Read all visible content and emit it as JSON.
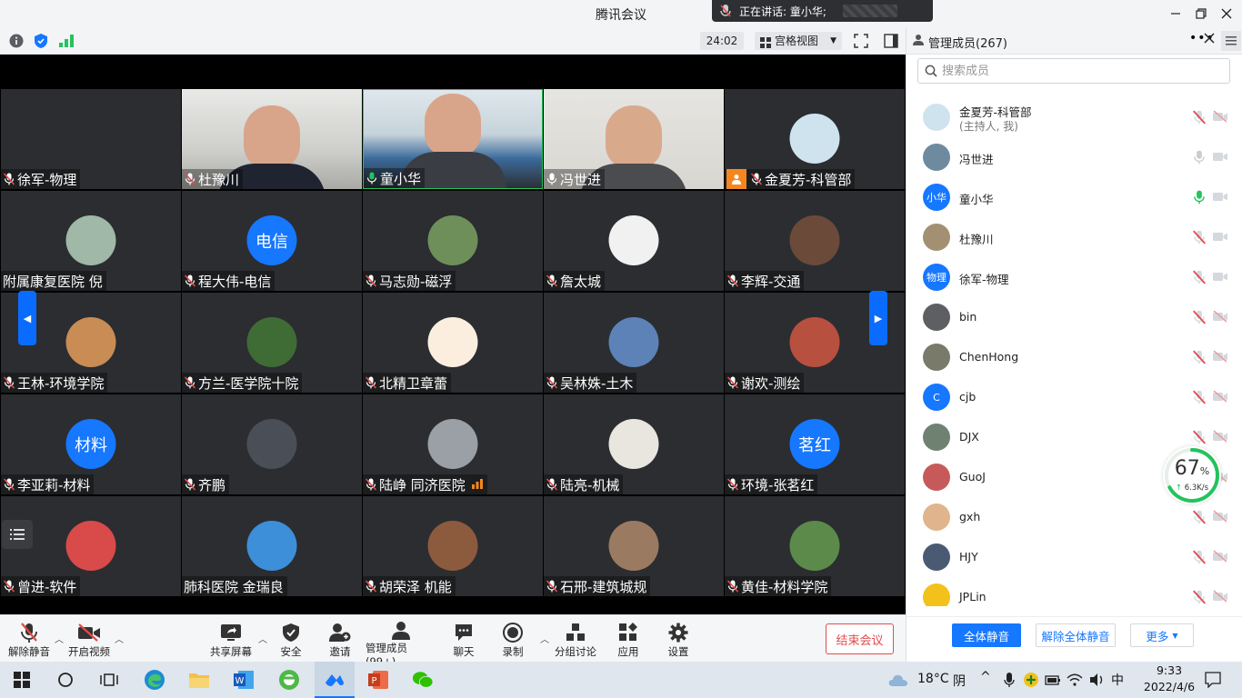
{
  "window": {
    "title": "腾讯会议",
    "speaking_label": "正在讲话: 童小华;"
  },
  "meeting_bar": {
    "timer": "24:02",
    "view_label": "宫格视图"
  },
  "tiles": [
    {
      "name": "徐军-物理",
      "kind": "blank",
      "mic": "muted"
    },
    {
      "name": "杜豫川",
      "kind": "cam1",
      "mic": "muted"
    },
    {
      "name": "童小华",
      "kind": "cam2",
      "mic": "speaking"
    },
    {
      "name": "冯世进",
      "kind": "cam3",
      "mic": "on"
    },
    {
      "name": "金夏芳-科管部",
      "kind": "avatar",
      "avatar_color": "#cfe3ef",
      "avatar_text": "",
      "mic": "muted",
      "host": true
    },
    {
      "name": "附属康复医院 倪",
      "kind": "avatar",
      "avatar_color": "#9fb8a8",
      "avatar_text": "",
      "mic": "none"
    },
    {
      "name": "程大伟-电信",
      "kind": "avatar",
      "avatar_color": "#1677ff",
      "avatar_text": "电信",
      "mic": "muted"
    },
    {
      "name": "马志勋-磁浮",
      "kind": "avatar",
      "avatar_color": "#6f8f5a",
      "avatar_text": "",
      "mic": "muted"
    },
    {
      "name": "詹太城",
      "kind": "avatar",
      "avatar_color": "#f1f1f1",
      "avatar_text": "",
      "mic": "muted"
    },
    {
      "name": "李辉-交通",
      "kind": "avatar",
      "avatar_color": "#6b4a3a",
      "avatar_text": "",
      "mic": "muted"
    },
    {
      "name": "王林-环境学院",
      "kind": "avatar",
      "avatar_color": "#c98c55",
      "avatar_text": "",
      "mic": "muted"
    },
    {
      "name": "方兰-医学院十院",
      "kind": "avatar",
      "avatar_color": "#3f6b34",
      "avatar_text": "",
      "mic": "muted"
    },
    {
      "name": "北精卫章蕾",
      "kind": "avatar",
      "avatar_color": "#fbeede",
      "avatar_text": "",
      "mic": "muted"
    },
    {
      "name": "吴林姝-土木",
      "kind": "avatar",
      "avatar_color": "#5c82b8",
      "avatar_text": "",
      "mic": "muted"
    },
    {
      "name": "谢欢-测绘",
      "kind": "avatar",
      "avatar_color": "#b8503f",
      "avatar_text": "",
      "mic": "muted"
    },
    {
      "name": "李亚莉-材料",
      "kind": "avatar",
      "avatar_color": "#1677ff",
      "avatar_text": "材料",
      "mic": "muted"
    },
    {
      "name": "齐鹏",
      "kind": "avatar",
      "avatar_color": "#4a4e57",
      "avatar_text": "",
      "mic": "muted"
    },
    {
      "name": "陆峥 同济医院",
      "kind": "avatar",
      "avatar_color": "#9aa0a5",
      "avatar_text": "",
      "mic": "muted",
      "signal": true
    },
    {
      "name": "陆亮-机械",
      "kind": "avatar",
      "avatar_color": "#e9e5df",
      "avatar_text": "",
      "mic": "muted"
    },
    {
      "name": "环境-张茗红",
      "kind": "avatar",
      "avatar_color": "#1677ff",
      "avatar_text": "茗红",
      "mic": "muted"
    },
    {
      "name": "曾进-软件",
      "kind": "avatar",
      "avatar_color": "#d94a4a",
      "avatar_text": "",
      "mic": "muted"
    },
    {
      "name": "肺科医院 金瑞良",
      "kind": "avatar",
      "avatar_color": "#3c8fd8",
      "avatar_text": "",
      "mic": "none"
    },
    {
      "name": "胡荣泽 机能",
      "kind": "avatar",
      "avatar_color": "#8c5a3c",
      "avatar_text": "",
      "mic": "muted"
    },
    {
      "name": "石邢-建筑城规",
      "kind": "avatar",
      "avatar_color": "#9b7a62",
      "avatar_text": "",
      "mic": "muted"
    },
    {
      "name": "黄佳-材料学院",
      "kind": "avatar",
      "avatar_color": "#5c8a4a",
      "avatar_text": "",
      "mic": "muted"
    }
  ],
  "toolbar": {
    "unmute": "解除静音",
    "start_video": "开启视频",
    "share_screen": "共享屏幕",
    "security": "安全",
    "invite": "邀请",
    "manage_members": "管理成员(99+)",
    "chat": "聊天",
    "record": "录制",
    "breakout": "分组讨论",
    "apps": "应用",
    "settings": "设置",
    "end_meeting": "结束会议"
  },
  "panel": {
    "title": "管理成员(267)",
    "search_placeholder": "搜索成员",
    "members": [
      {
        "name": "金夏芳-科管部",
        "sub": "(主持人, 我)",
        "avatar_color": "#cfe3ef",
        "avatar_text": "",
        "mic": "muted",
        "cam": "off"
      },
      {
        "name": "冯世进",
        "sub": "",
        "avatar_color": "#6e8a9e",
        "avatar_text": "",
        "mic": "idle",
        "cam": "on"
      },
      {
        "name": "童小华",
        "sub": "",
        "avatar_color": "#1677ff",
        "avatar_text": "小华",
        "mic": "speaking",
        "cam": "on"
      },
      {
        "name": "杜豫川",
        "sub": "",
        "avatar_color": "#a39072",
        "avatar_text": "",
        "mic": "muted",
        "cam": "on"
      },
      {
        "name": "徐军-物理",
        "sub": "",
        "avatar_color": "#1677ff",
        "avatar_text": "物理",
        "mic": "muted",
        "cam": "on"
      },
      {
        "name": "bin",
        "sub": "",
        "avatar_color": "#5d5f63",
        "avatar_text": "",
        "mic": "muted",
        "cam": "off"
      },
      {
        "name": "ChenHong",
        "sub": "",
        "avatar_color": "#7a7a6a",
        "avatar_text": "",
        "mic": "muted",
        "cam": "off"
      },
      {
        "name": "cjb",
        "sub": "",
        "avatar_color": "#1677ff",
        "avatar_text": "C",
        "mic": "muted",
        "cam": "off"
      },
      {
        "name": "DJX",
        "sub": "",
        "avatar_color": "#6f8272",
        "avatar_text": "",
        "mic": "muted",
        "cam": "off"
      },
      {
        "name": "GuoJ",
        "sub": "",
        "avatar_color": "#c65a5a",
        "avatar_text": "",
        "mic": "muted",
        "cam": "off"
      },
      {
        "name": "gxh",
        "sub": "",
        "avatar_color": "#e0b48c",
        "avatar_text": "",
        "mic": "muted",
        "cam": "off"
      },
      {
        "name": "HJY",
        "sub": "",
        "avatar_color": "#4a5a72",
        "avatar_text": "",
        "mic": "muted",
        "cam": "off"
      },
      {
        "name": "JPLin",
        "sub": "",
        "avatar_color": "#f2c21b",
        "avatar_text": "",
        "mic": "muted",
        "cam": "off"
      }
    ],
    "mute_all": "全体静音",
    "unmute_all": "解除全体静音",
    "more": "更多"
  },
  "network": {
    "percent": "67",
    "percent_sign": "%",
    "speed": "6.3K/s",
    "level": 0.67
  },
  "taskbar": {
    "temperature": "18°C",
    "weather": "阴",
    "ime": "中",
    "time": "9:33",
    "date": "2022/4/6"
  },
  "colors": {
    "accent": "#1677ff",
    "danger": "#e24b4b",
    "speaking": "#23c35d"
  }
}
